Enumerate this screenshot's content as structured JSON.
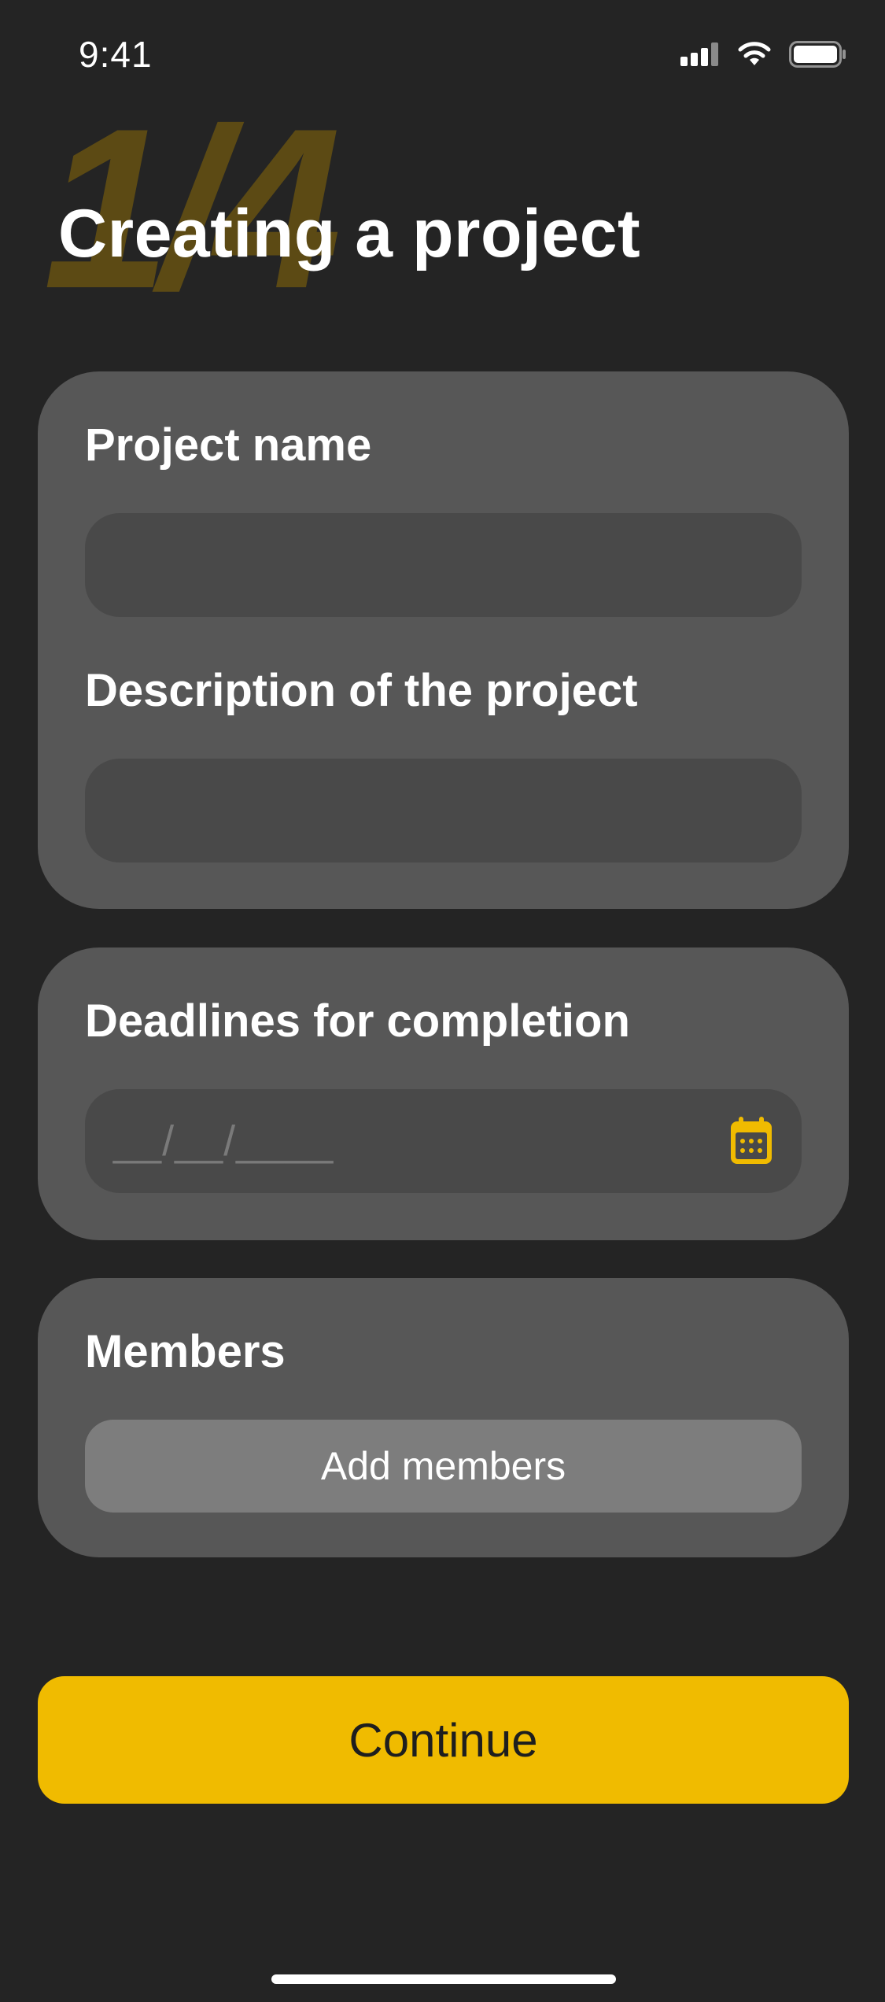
{
  "status_bar": {
    "time": "9:41",
    "icons": [
      "cellular-signal-icon",
      "wifi-icon",
      "battery-icon"
    ]
  },
  "header": {
    "step": "1/4",
    "title": "Creating a project"
  },
  "form": {
    "project_name": {
      "label": "Project name",
      "value": "",
      "placeholder": ""
    },
    "description": {
      "label": "Description of the project",
      "value": "",
      "placeholder": ""
    },
    "deadline": {
      "label": "Deadlines for completion",
      "mask": "__/__/____",
      "icon": "calendar-icon"
    },
    "members": {
      "label": "Members",
      "button_label": "Add members"
    }
  },
  "actions": {
    "continue_label": "Continue"
  },
  "colors": {
    "background": "#242424",
    "card": "#575757",
    "field": "#494949",
    "accent": "#f0bb00",
    "step_number": "#5c4a14",
    "secondary_button": "#7d7d7d"
  }
}
